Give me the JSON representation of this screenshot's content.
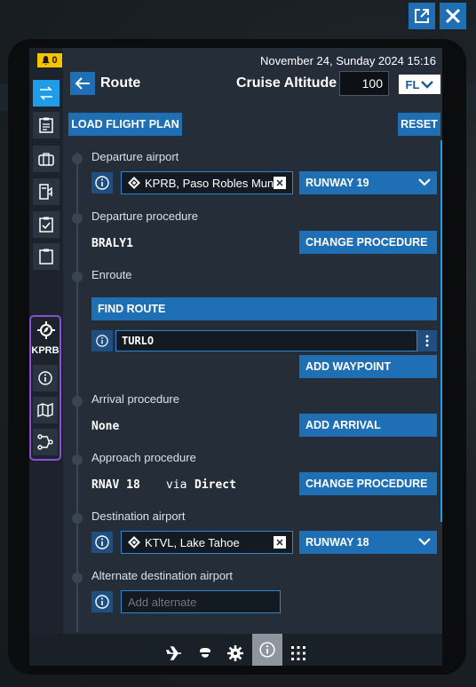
{
  "window": {
    "popout_icon": "external-link-icon",
    "close_icon": "close-icon"
  },
  "status": {
    "notification_count": "0",
    "datetime": "November 24, Sunday 2024 15:16"
  },
  "header": {
    "title": "Route",
    "cruise_altitude_label": "Cruise Altitude",
    "cruise_altitude_value": "100",
    "unit_label": "FL"
  },
  "sidebar": {
    "items": [
      {
        "icon": "route-icon",
        "active": true
      },
      {
        "icon": "clipboard-list-icon"
      },
      {
        "icon": "briefcase-icon"
      },
      {
        "icon": "fuel-icon"
      },
      {
        "icon": "checklist-icon"
      },
      {
        "icon": "clipboard-icon"
      }
    ],
    "airport_group": {
      "code": "KPRB",
      "items": [
        {
          "icon": "info-icon"
        },
        {
          "icon": "map-icon"
        },
        {
          "icon": "route-nodes-icon"
        }
      ]
    }
  },
  "actions": {
    "load_flight_plan": "LOAD FLIGHT PLAN",
    "reset": "RESET"
  },
  "departure": {
    "label": "Departure airport",
    "airport": "KPRB, Paso Robles Muni",
    "runway": "RUNWAY 19"
  },
  "departure_procedure": {
    "label": "Departure procedure",
    "value": "BRALY1",
    "button": "CHANGE PROCEDURE"
  },
  "enroute": {
    "label": "Enroute",
    "find_route": "FIND ROUTE",
    "waypoint": "TURLO",
    "add_waypoint": "ADD WAYPOINT"
  },
  "arrival": {
    "label": "Arrival procedure",
    "value": "None",
    "button": "ADD ARRIVAL"
  },
  "approach": {
    "label": "Approach procedure",
    "value": "RNAV 18",
    "via_label": "via",
    "via_value": "Direct",
    "button": "CHANGE PROCEDURE"
  },
  "destination": {
    "label": "Destination airport",
    "airport": "KTVL, Lake Tahoe",
    "runway": "RUNWAY 18"
  },
  "alternate": {
    "label": "Alternate destination airport",
    "placeholder": "Add alternate"
  },
  "bottom_nav": [
    {
      "icon": "airplane-icon"
    },
    {
      "icon": "pilot-icon"
    },
    {
      "icon": "gear-icon"
    },
    {
      "icon": "info-icon",
      "active": true
    },
    {
      "icon": "apps-grid-icon"
    }
  ],
  "colors": {
    "accent": "#1e6fb3",
    "active": "#1f9ce8",
    "badge": "#f7c400",
    "group_border": "#8a4dd8"
  }
}
